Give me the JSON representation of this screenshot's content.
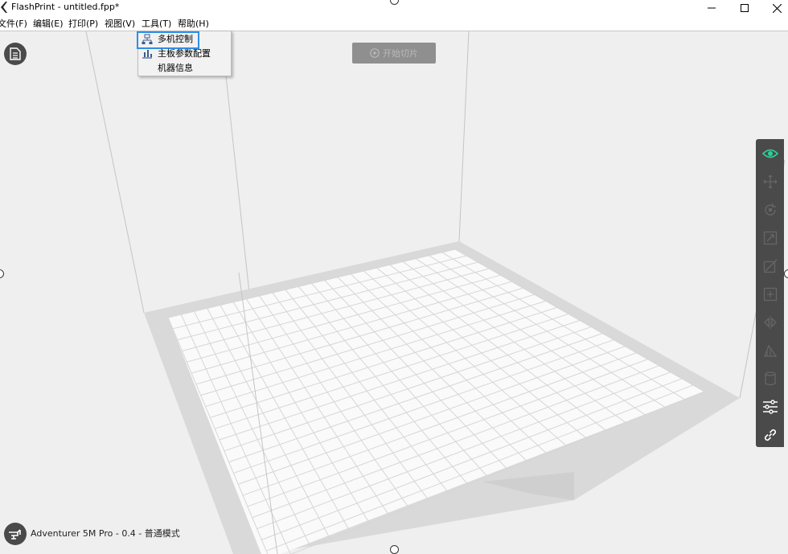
{
  "window": {
    "title": "FlashPrint - untitled.fpp*"
  },
  "menubar": {
    "items": [
      {
        "label": "文件(F)"
      },
      {
        "label": "编辑(E)"
      },
      {
        "label": "打印(P)"
      },
      {
        "label": "视图(V)"
      },
      {
        "label": "工具(T)"
      },
      {
        "label": "帮助(H)"
      }
    ]
  },
  "tools_menu": {
    "items": [
      {
        "label": "多机控制",
        "icon": "multi-machine-icon",
        "highlighted": true
      },
      {
        "label": "主板参数配置",
        "icon": "board-config-icon"
      },
      {
        "label": "机器信息",
        "icon": ""
      }
    ]
  },
  "slice_button": {
    "label": "开始切片",
    "icon": "play-circle-icon",
    "enabled": false
  },
  "right_toolbar": {
    "tools": [
      {
        "name": "view-icon",
        "active": true
      },
      {
        "name": "move-icon",
        "active": false
      },
      {
        "name": "rotate-icon",
        "active": false
      },
      {
        "name": "scale-icon",
        "active": false
      },
      {
        "name": "cut-icon",
        "active": false
      },
      {
        "name": "add-icon",
        "active": false
      },
      {
        "name": "mirror-icon",
        "active": false
      },
      {
        "name": "supports-icon",
        "active": false
      },
      {
        "name": "extruder-icon",
        "active": false
      },
      {
        "name": "settings-sliders-icon",
        "active": true
      },
      {
        "name": "link-icon",
        "active": true
      }
    ]
  },
  "status": {
    "printer": "Adventurer 5M Pro - 0.4 - 普通模式"
  },
  "colors": {
    "accent": "#2fd09a",
    "toolbar_bg": "#4a4a4a",
    "highlight_border": "#2f8fe3",
    "bed_platform": "#d9d9d9",
    "bed_grid": "#fafafa"
  }
}
